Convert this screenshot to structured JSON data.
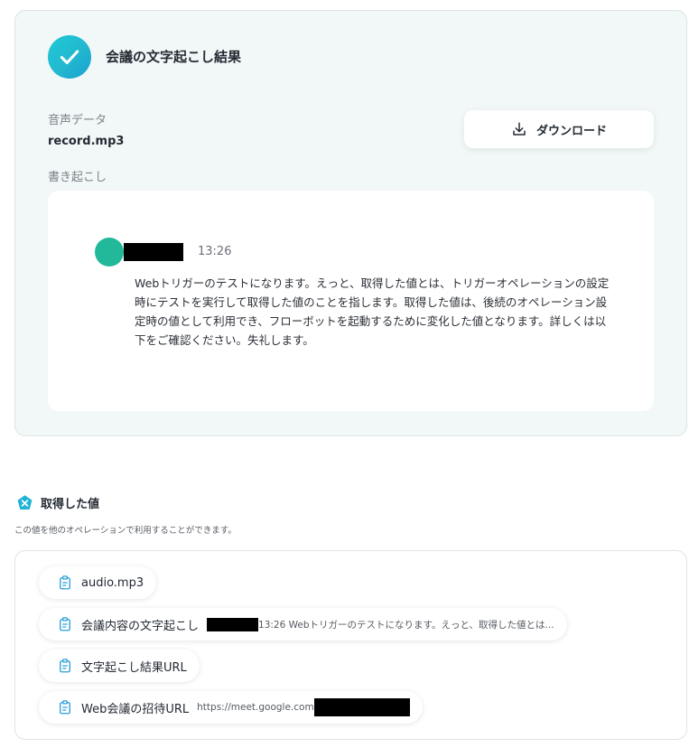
{
  "card": {
    "title": "会議の文字起こし結果",
    "audio_label": "音声データ",
    "audio_filename": "record.mp3",
    "transcript_label": "書き起こし",
    "download_label": "ダウンロード"
  },
  "transcript": {
    "time": "13:26",
    "text": "Webトリガーのテストになります。えっと、取得した値とは、トリガーオペレーションの設定時にテストを実行して取得した値のことを指します。取得した値は、後続のオペレーション設定時の値として利用でき、フローボットを起動するために変化した値となります。詳しくは以下をご確認ください。失礼します。"
  },
  "values_section": {
    "title": "取得した値",
    "description": "この値を他のオペレーションで利用することができます。",
    "items": [
      {
        "label": "audio.mp3",
        "value": ""
      },
      {
        "label": "会議内容の文字起こし",
        "value": "13:26 Webトリガーのテストになります。えっと、取得した値とは..."
      },
      {
        "label": "文字起こし結果URL",
        "value": ""
      },
      {
        "label": "Web会議の招待URL",
        "value": "https://meet.google.com"
      }
    ]
  },
  "colors": {
    "accent": "#1fc9d6",
    "card_bg": "#f1f8f7",
    "avatar": "#22b89a",
    "value_icon": "#2a9fd8"
  }
}
